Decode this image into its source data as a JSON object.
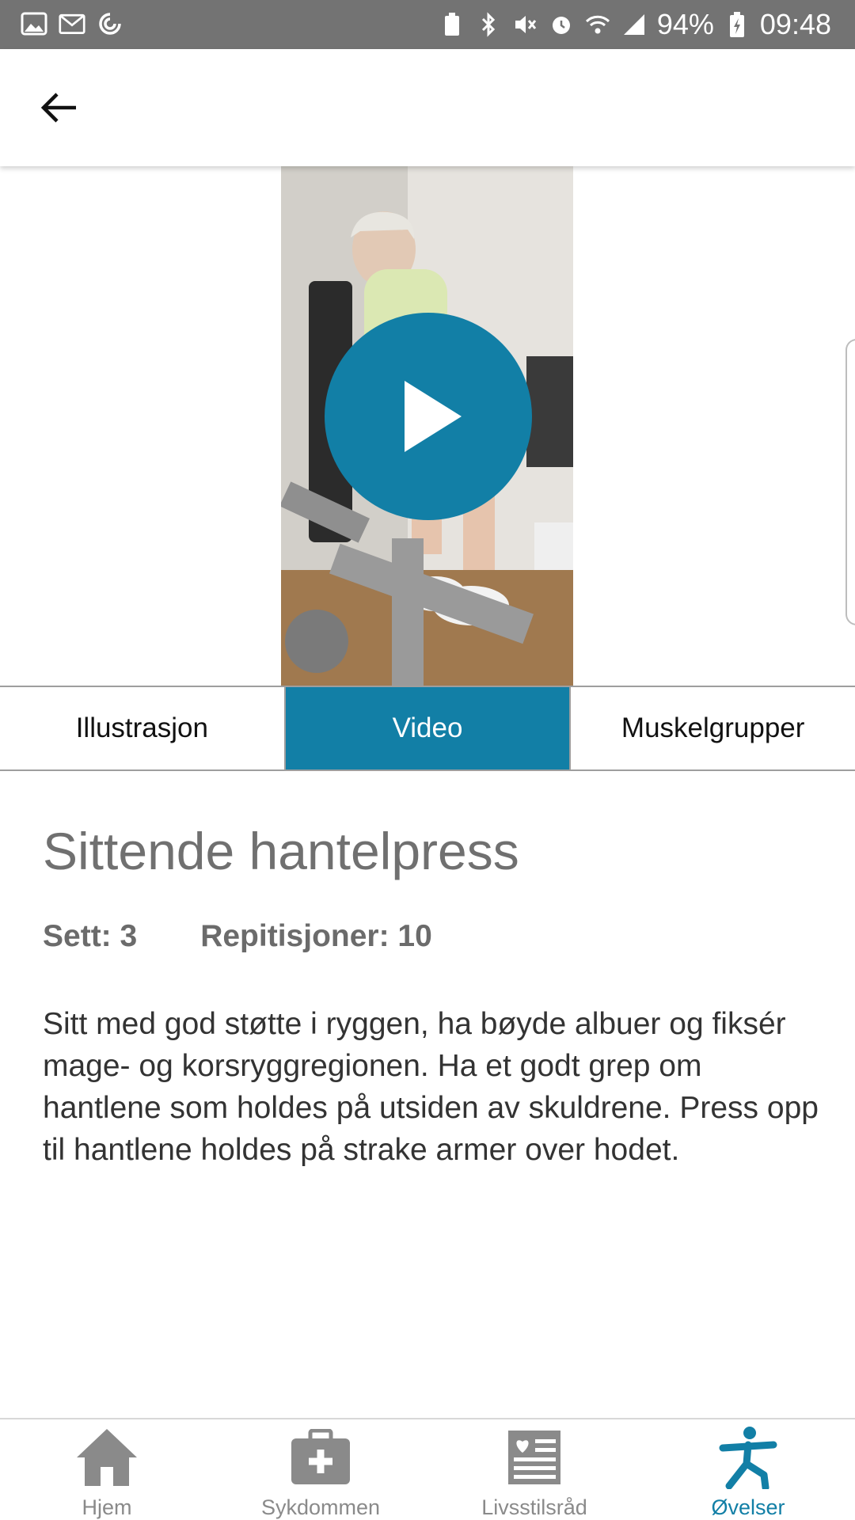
{
  "status_bar": {
    "battery": "94%",
    "time": "09:48"
  },
  "exercise": {
    "title": "Sittende hantelpress",
    "sets": "Sett: 3",
    "reps": "Repitisjoner: 10",
    "description": "Sitt med god støtte i ryggen, ha bøyde albuer og fiksér mage- og korsryggregionen. Ha et godt grep om hantlene som holdes på utsiden av skuldrene. Press opp til hantlene holdes på strake armer over hodet."
  },
  "tabs": [
    {
      "label": "Illustrasjon",
      "active": false
    },
    {
      "label": "Video",
      "active": true
    },
    {
      "label": "Muskelgrupper",
      "active": false
    }
  ],
  "bottom_nav": [
    {
      "label": "Hjem",
      "icon": "home-icon",
      "active": false
    },
    {
      "label": "Sykdommen",
      "icon": "medical-kit-icon",
      "active": false
    },
    {
      "label": "Livsstilsråd",
      "icon": "heart-list-icon",
      "active": false
    },
    {
      "label": "Øvelser",
      "icon": "exercise-figure-icon",
      "active": true
    }
  ],
  "colors": {
    "accent": "#127fa6",
    "status_bar": "#737373",
    "inactive_nav": "#8a8a8a"
  }
}
